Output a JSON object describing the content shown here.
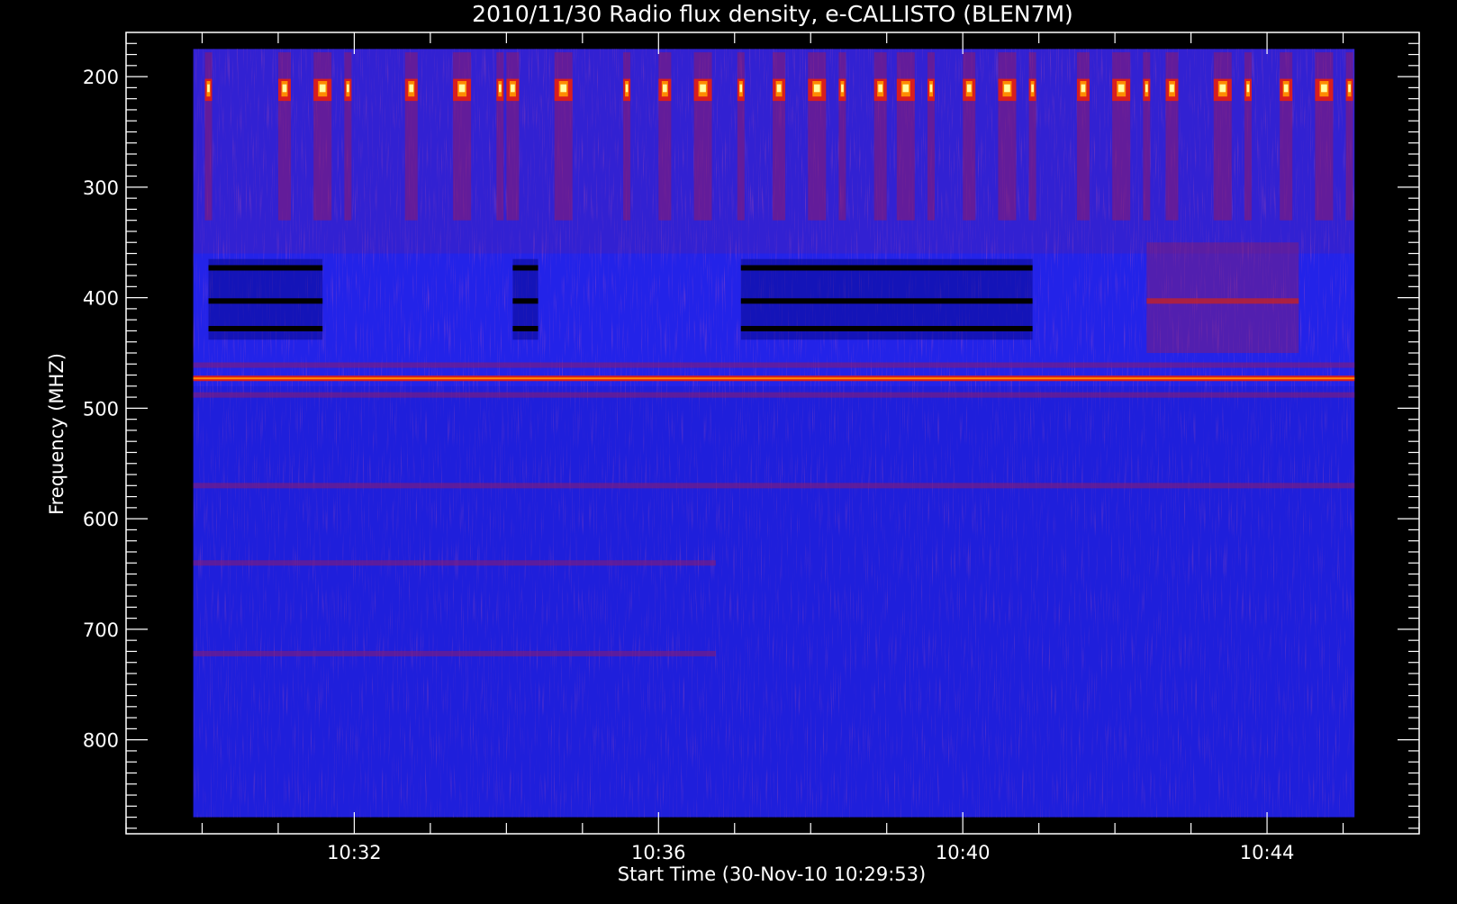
{
  "chart_data": {
    "type": "heatmap",
    "title": "2010/11/30  Radio flux density, e-CALLISTO (BLEN7M)",
    "xlabel": "Start Time (30-Nov-10 10:29:53)",
    "ylabel": "Frequency (MHZ)",
    "xlim_minutes": [
      "10:29:53",
      "10:45:09"
    ],
    "axis_xlim": [
      "10:29:00",
      "10:46:00"
    ],
    "ylim": [
      870,
      175
    ],
    "axis_ylim": [
      885,
      160
    ],
    "x_ticks": [
      "10:32",
      "10:36",
      "10:40",
      "10:44"
    ],
    "y_ticks": [
      200,
      300,
      400,
      500,
      600,
      700,
      800
    ],
    "y_scale": "linear",
    "grid": false,
    "colormap": [
      "#000000",
      "#0b0b80",
      "#2323e8",
      "#8c1a6b",
      "#d81e1e",
      "#ff8c00",
      "#ffff80",
      "#ffffff"
    ],
    "background_color": "#2323e8",
    "features": {
      "bursts_210MHz_times": [
        "10:30:05",
        "10:31:05",
        "10:31:35",
        "10:31:55",
        "10:32:45",
        "10:33:25",
        "10:33:55",
        "10:34:05",
        "10:34:45",
        "10:35:35",
        "10:36:05",
        "10:36:35",
        "10:37:05",
        "10:37:35",
        "10:38:05",
        "10:38:25",
        "10:38:55",
        "10:39:15",
        "10:39:35",
        "10:40:05",
        "10:40:35",
        "10:40:55",
        "10:41:35",
        "10:42:05",
        "10:42:25",
        "10:42:45",
        "10:43:25",
        "10:43:45",
        "10:44:15",
        "10:44:45",
        "10:45:05"
      ],
      "dark_band_frequencies_MHz": [
        373,
        403,
        428
      ],
      "dark_band_time_spans": [
        [
          "10:30:05",
          "10:31:35"
        ],
        [
          "10:34:05",
          "10:34:25"
        ],
        [
          "10:37:05",
          "10:40:55"
        ]
      ],
      "interference_line_MHz": 473,
      "weak_lines_MHz": [
        461,
        488,
        570,
        640,
        722
      ],
      "red_patch": {
        "freq_MHz": [
          350,
          450
        ],
        "time_span": [
          "10:42:25",
          "10:44:25"
        ]
      }
    }
  }
}
